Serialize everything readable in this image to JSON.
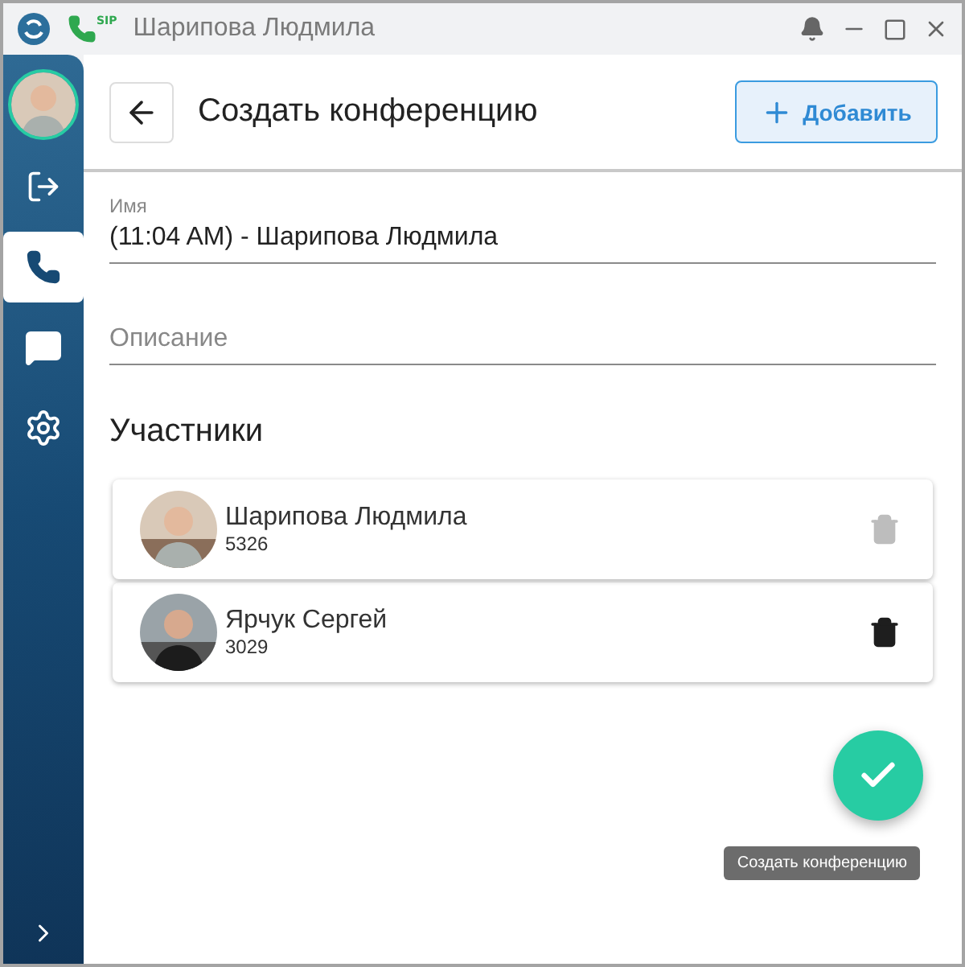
{
  "window": {
    "title": "Шарипова Людмила",
    "badge": "SIP"
  },
  "sidebar": {
    "items": [
      {
        "kind": "avatar",
        "selected": false
      },
      {
        "kind": "logout",
        "selected": false
      },
      {
        "kind": "phone",
        "selected": true
      },
      {
        "kind": "chat",
        "selected": false
      },
      {
        "kind": "settings",
        "selected": false
      }
    ]
  },
  "header": {
    "title": "Создать конференцию",
    "add_button": "Добавить"
  },
  "form": {
    "name": {
      "label": "Имя",
      "value": "(11:04 AM) - Шарипова Людмила"
    },
    "description": {
      "placeholder": "Описание"
    }
  },
  "participants": {
    "title": "Участники",
    "items": [
      {
        "name": "Шарипова Людмила",
        "number": "5326",
        "delete_disabled": true
      },
      {
        "name": "Ярчук Сергей",
        "number": "3029",
        "delete_disabled": false
      }
    ]
  },
  "fab": {
    "tooltip": "Создать конференцию"
  }
}
